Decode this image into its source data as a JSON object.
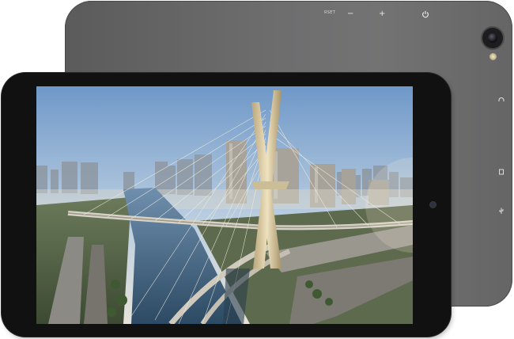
{
  "back_panel": {
    "reset_label": "RSET",
    "volume_down_symbol": "−",
    "volume_up_symbol": "+",
    "power_icon": "power-icon",
    "camera_icon": "rear-camera-icon",
    "flash_icon": "flash-led-icon",
    "side_icons": [
      "headphone-jack-icon",
      "sd-card-icon",
      "usb-port-icon"
    ]
  },
  "screen": {
    "wallpaper": "city-bridge-photo",
    "colors": {
      "sky_top": "#6f98c8",
      "sky_bottom": "#dfe6ea",
      "river": "#3a5d7a",
      "pylon": "#d9c9a0"
    }
  }
}
